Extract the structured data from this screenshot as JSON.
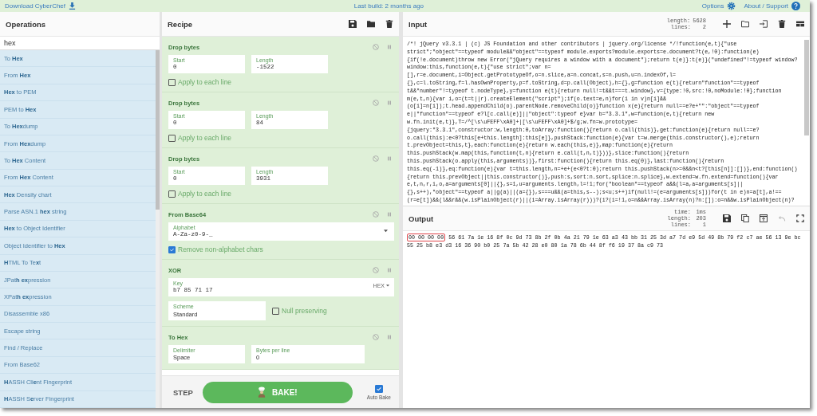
{
  "top_bar": {
    "download_link": "Download CyberChef",
    "last_build": "Last build: 2 months ago",
    "options_link": "Options",
    "about_link": "About / Support"
  },
  "operations": {
    "title": "Operations",
    "search": {
      "value": "hex"
    },
    "items": [
      "To **Hex**",
      "From **Hex**",
      "**Hex** to PEM",
      "PEM to **Hex**",
      "To **Hex**dump",
      "From **Hex**dump",
      "To **Hex** Content",
      "From **Hex** Content",
      "**Hex** Density chart",
      "Parse ASN.1 **hex** string",
      "**Hex** to Object Identifier",
      "Object Identifier to **Hex**",
      "**H**TML To Te**x**t",
      "JPat**h ex**pression",
      "XPat**h ex**pression",
      "Disassemble x86",
      "Escape string",
      "Find / Replace",
      "From Base62",
      "**H**ASSH Cli**e**nt Fingerprint",
      "**H**ASSH S**e**rver Fingerprint"
    ]
  },
  "recipe": {
    "title": "Recipe",
    "steps": [
      {
        "title": "Drop bytes",
        "fields": [
          {
            "kind": "text",
            "label": "Start",
            "value": "0"
          },
          {
            "kind": "text",
            "label": "Length",
            "value": "-1522"
          },
          {
            "kind": "checkbox",
            "label": "Apply to each line",
            "checked": false
          }
        ]
      },
      {
        "title": "Drop bytes",
        "fields": [
          {
            "kind": "text",
            "label": "Start",
            "value": "0"
          },
          {
            "kind": "text",
            "label": "Length",
            "value": "84"
          },
          {
            "kind": "checkbox",
            "label": "Apply to each line",
            "checked": false
          }
        ]
      },
      {
        "title": "Drop bytes",
        "fields": [
          {
            "kind": "text",
            "label": "Start",
            "value": "0"
          },
          {
            "kind": "text",
            "label": "Length",
            "value": "3931"
          },
          {
            "kind": "checkbox",
            "label": "Apply to each line",
            "checked": false
          }
        ]
      },
      {
        "title": "From Base64",
        "fields": [
          {
            "kind": "select",
            "label": "Alphabet",
            "value": "A-Za-z0-9-_"
          },
          {
            "kind": "checkbox",
            "label": "Remove non-alphabet chars",
            "checked": true
          }
        ]
      },
      {
        "title": "XOR",
        "fields": [
          {
            "kind": "toggle",
            "label": "Key",
            "value": "b7 85 71 17",
            "option": "HEX"
          },
          {
            "kind": "text",
            "label": "Scheme",
            "value": "Standard"
          },
          {
            "kind": "checkbox",
            "label": "Null preserving",
            "checked": false
          }
        ]
      },
      {
        "title": "To Hex",
        "fields": [
          {
            "kind": "text",
            "label": "Delimiter",
            "value": "Space"
          },
          {
            "kind": "text",
            "label": "Bytes per line",
            "value": "0"
          }
        ]
      }
    ],
    "step_button": "STEP",
    "bake_button": "BAKE!",
    "auto_bake": {
      "label": "Auto Bake",
      "checked": true
    }
  },
  "input": {
    "title": "Input",
    "stats": [
      {
        "label": "length:",
        "value": "5628"
      },
      {
        "label": "lines:",
        "value": "2"
      }
    ],
    "text_lines": [
      "/*! jQuery v3.3.1 | (c) JS Foundation and other contributors | jquery.org/license */!function(e,t){\"use",
      "strict\";\"object\"==typeof module&&\"object\"==typeof module.exports?module.exports=e.document?t(e,!0):function(e)",
      "{if(!e.document)throw new Error(\"jQuery requires a window with a document\");return t(e)}:t(e)}(\"undefined\"!=typeof window?",
      "window:this,function(e,t){\"use strict\";var n=",
      "[],r=e.document,i=Object.getPrototypeOf,o=n.slice,a=n.concat,s=n.push,u=n.indexOf,l=",
      "{},c=l.toString,f=l.hasOwnProperty,p=f.toString,d=p.call(Object),h={},g=function e(t){return\"function\"==typeof",
      "t&&\"number\"!=typeof t.nodeType},y=function e(t){return null!=t&&t===t.window},v={type:!0,src:!0,noModule:!0};function",
      "m(e,t,n){var i,o=(t=t||r).createElement(\"script\");if(o.text=e,n)for(i in v)n[i]&&",
      "(o[i]=n[i]);t.head.appendChild(o).parentNode.removeChild(o)}function x(e){return null==e?e+\"\":\"object\"==typeof",
      "e||\"function\"==typeof e?l[c.call(e)]||\"object\":typeof e}var b=\"3.3.1\",w=function(e,t){return new",
      "w.fn.init(e,t)},T=/^[\\s\\uFEFF\\xA0]+|[\\s\\uFEFF\\xA0]+$/g;w.fn=w.prototype=",
      "{jquery:\"3.3.1\",constructor:w,length:0,toArray:function(){return o.call(this)},get:function(e){return null==e?",
      "o.call(this):e<0?this[e+this.length]:this[e]},pushStack:function(e){var t=w.merge(this.constructor(),e);return",
      "t.prevObject=this,t},each:function(e){return w.each(this,e)},map:function(e){return",
      "this.pushStack(w.map(this,function(t,n){return e.call(t,n,t)}))},slice:function(){return",
      "this.pushStack(o.apply(this,arguments))},first:function(){return this.eq(0)},last:function(){return",
      "this.eq(-1)},eq:function(e){var t=this.length,n=+e+(e<0?t:0);return this.pushStack(n>=0&&n<t?[this[n]]:[])},end:function()",
      "{return this.prevObject||this.constructor()},push:s,sort:n.sort,splice:n.splice},w.extend=w.fn.extend=function(){var",
      "e,t,n,r,i,o,a=arguments[0]||{},s=1,u=arguments.length,l=!1;for(\"boolean\"==typeof a&&(l=a,a=arguments[s]||",
      "{},s++),\"object\"==typeof a||g(a)||(a={}),s===u&&(a=this,s--);s<u;s++)if(null!=(e=arguments[s]))for(t in e)n=a[t],a!==",
      "(r=e[t])&&(l&&r&&(w.isPlainObject(r)||(i=Array.isArray(r)))?(i?(i=!1,o=n&&Array.isArray(n)?n:[]):o=n&&w.isPlainObject(n)?"
    ]
  },
  "output": {
    "title": "Output",
    "stats": [
      {
        "label": "time:",
        "value": "1ms"
      },
      {
        "label": "length:",
        "value": "203"
      },
      {
        "label": "lines:",
        "value": "1"
      }
    ],
    "highlight": "00 00 00 00",
    "text_lines": [
      "56 61 7a 1e 16 8f 0c 9d 73 8b 2f 0b 4a 21 79 1e 63 a3 43 bb 31 25 3d a7 7d e9 5d 49 8b 79 f2 c7 ae 56 13 9e bc",
      "55 25 b8 e3 d3 16 36 90 b0 25 7a 5b 42 28 e0 80 1a 78 6b 44 8f f6 19 37 8a c9 73"
    ]
  }
}
